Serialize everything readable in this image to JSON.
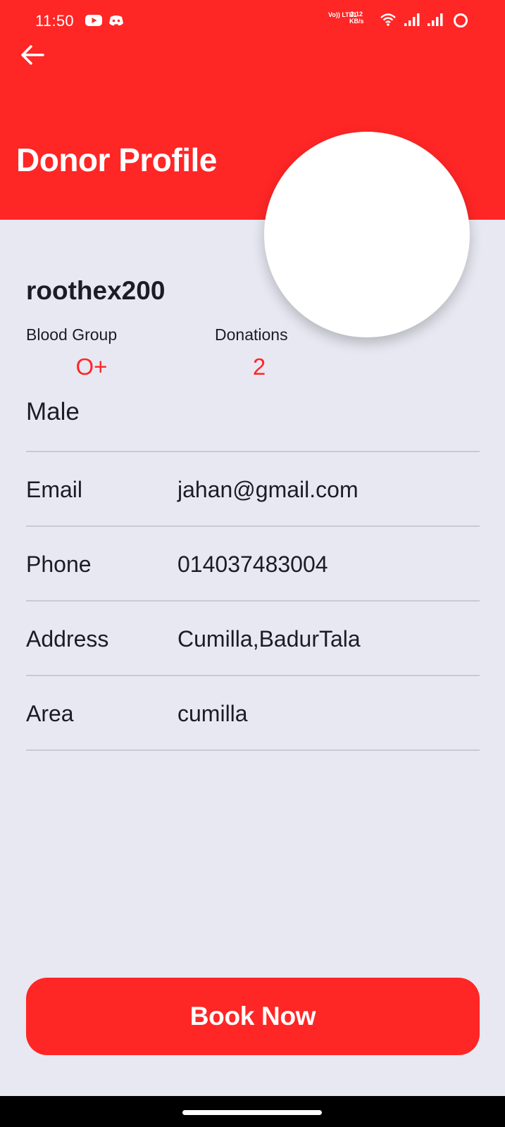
{
  "status_bar": {
    "time": "11:50",
    "network_tag": "Vo)) LTE1",
    "speed_value": "3.12",
    "speed_unit": "KB/s",
    "icons": [
      "youtube-icon",
      "discord-icon",
      "wifi-icon",
      "signal-icon",
      "signal-icon",
      "battery-icon"
    ]
  },
  "header": {
    "title": "Donor Profile",
    "back_icon": "arrow-left-icon",
    "color": "#ff2626"
  },
  "profile": {
    "username": "roothex200",
    "blood_group_label": "Blood Group",
    "blood_group_value": "O+",
    "donations_label": "Donations",
    "donations_value": "2",
    "gender": "Male"
  },
  "details": [
    {
      "label": "Email",
      "value": "jahan@gmail.com"
    },
    {
      "label": "Phone",
      "value": "014037483004"
    },
    {
      "label": "Address",
      "value": "Cumilla,BadurTala"
    },
    {
      "label": "Area",
      "value": "cumilla"
    }
  ],
  "actions": {
    "book_label": "Book Now"
  },
  "colors": {
    "accent": "#ff2626",
    "background": "#e8e8f2",
    "divider": "#c9c9d2"
  }
}
